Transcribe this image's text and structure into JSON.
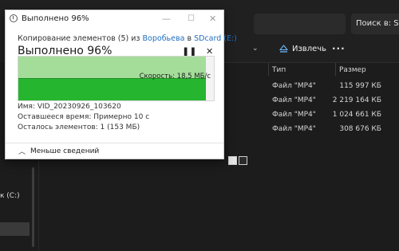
{
  "explorer": {
    "search_text": "Поиск в: SDcard",
    "toolbar": {
      "eject_label": "Извлечь",
      "more_label": "..."
    },
    "columns": {
      "type": "Тип",
      "size": "Размер"
    },
    "rows": [
      {
        "type": "Файл \"MP4\"",
        "size": "115 997 КБ"
      },
      {
        "type": "Файл \"MP4\"",
        "size": "2 219 164 КБ"
      },
      {
        "type": "Файл \"MP4\"",
        "size": "1 024 661 КБ"
      },
      {
        "type": "Файл \"MP4\"",
        "size": "308 676 КБ"
      }
    ],
    "nav_drive_label": "к (C:)"
  },
  "dialog": {
    "title": "Выполнено 96%",
    "from_prefix": "Копирование элементов (5) из",
    "from_source": "Воробьева",
    "from_mid": "в",
    "from_dest": "SDcard (E:)",
    "heading": "Выполнено 96%",
    "pause_icon": "pause-icon",
    "close_icon": "close-icon",
    "progress": 0.96,
    "speed_text": "Скорость: 18,5 МБ/с",
    "name_line": "Имя: VID_20230926_103620",
    "remaining_time_line": "Оставшееся время: Примерно 10 с",
    "remaining_items_line": "Осталось элементов: 1 (153 МБ)",
    "less_details_label": "Меньше сведений"
  },
  "colors": {
    "progress_done": "#a4dd9a",
    "progress_fill": "#26b52f",
    "link": "#1f6fc1",
    "explorer_bg": "#1c1c1c"
  }
}
